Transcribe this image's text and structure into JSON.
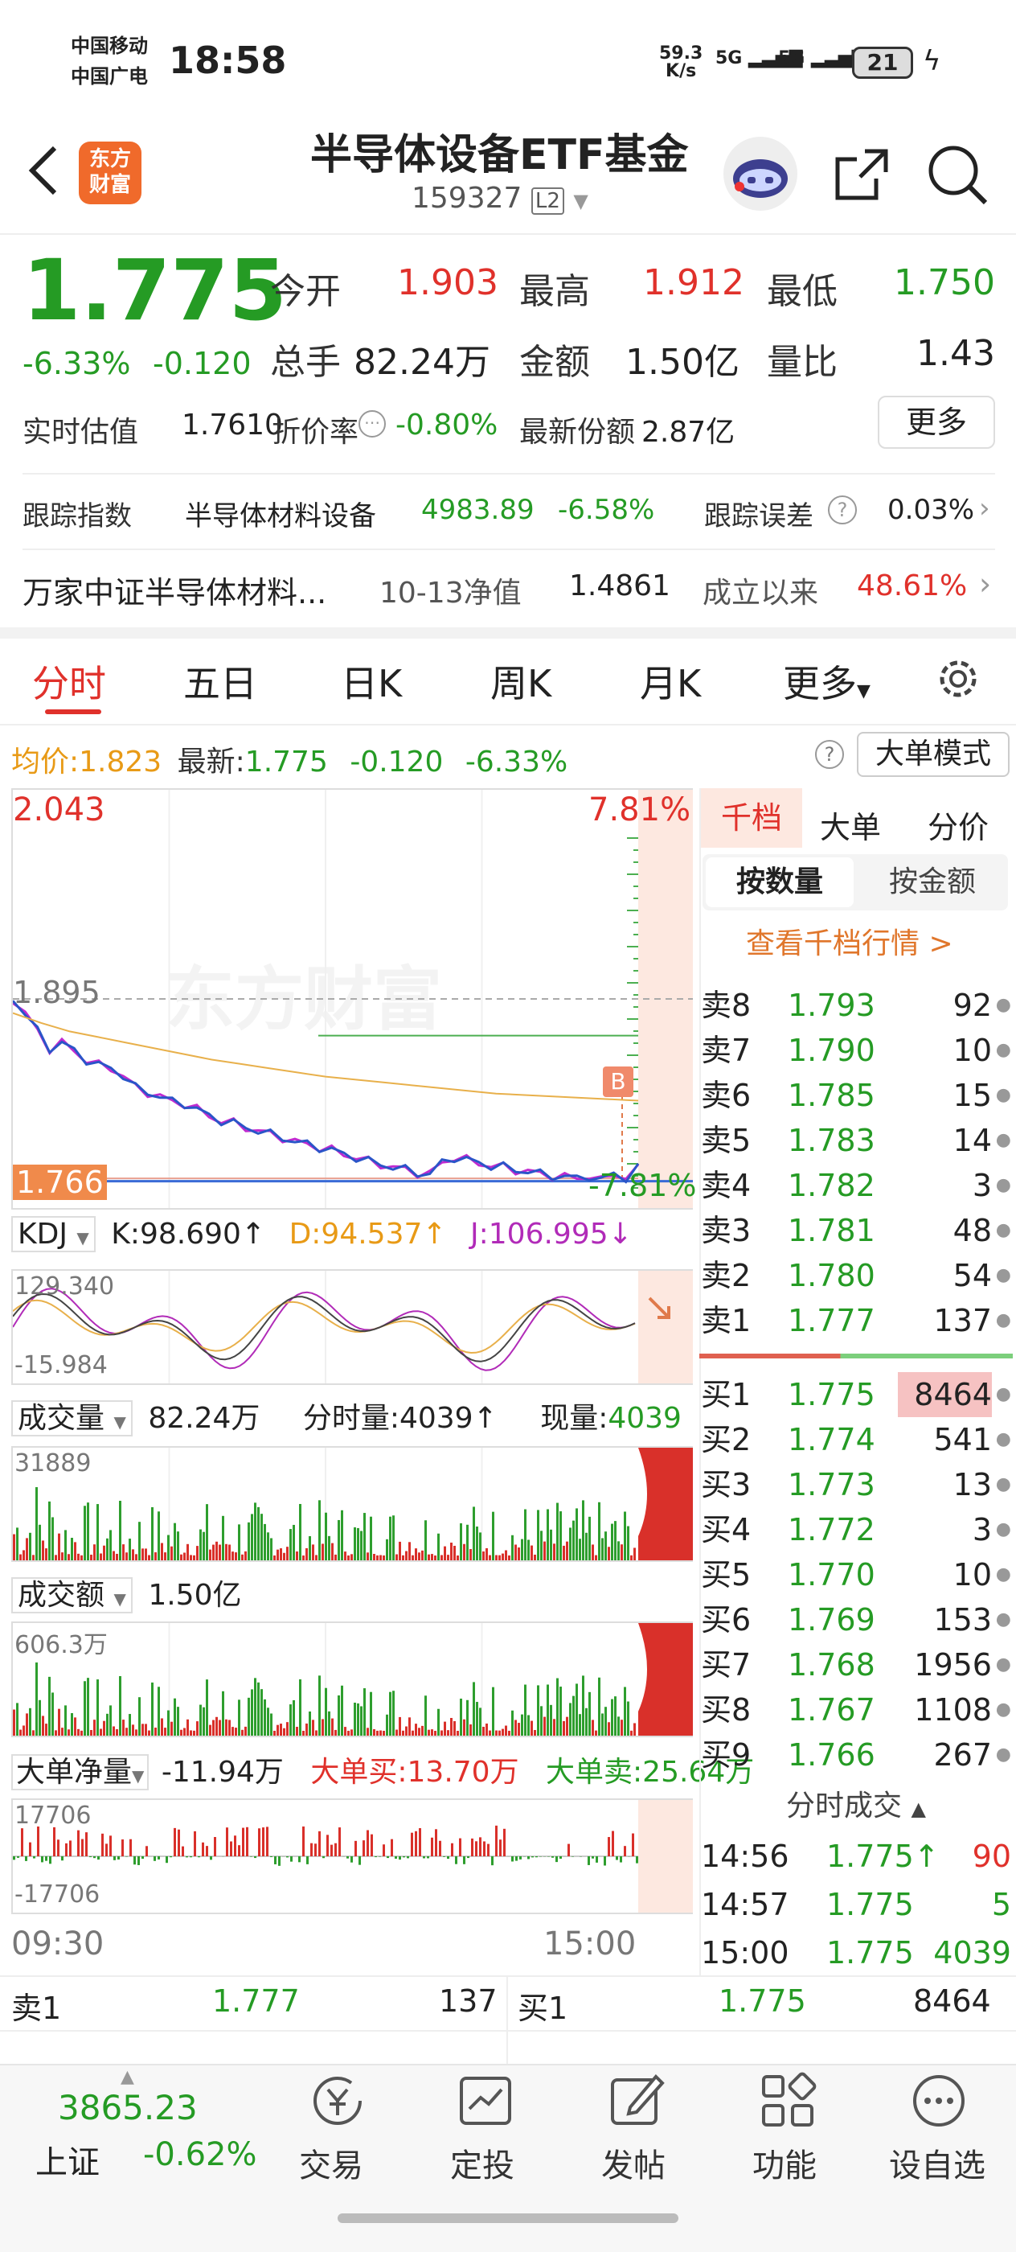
{
  "status": {
    "carrier1": "中国移动",
    "carrier2": "中国广电",
    "time": "18:58",
    "speed_val": "59.3",
    "speed_unit": "K/s",
    "sig1": "5G",
    "sig2": "5G",
    "battery": "21"
  },
  "header": {
    "logo_line1": "东方",
    "logo_line2": "财富",
    "title": "半导体设备ETF基金",
    "code": "159327",
    "badge": "L2"
  },
  "quote": {
    "price": "1.775",
    "pct": "-6.33%",
    "chg": "-0.120",
    "open_l": "今开",
    "open": "1.903",
    "high_l": "最高",
    "high": "1.912",
    "low_l": "最低",
    "low": "1.750",
    "vol_l": "总手",
    "vol": "82.24万",
    "amt_l": "金额",
    "amt": "1.50亿",
    "ratio_l": "量比",
    "ratio": "1.43",
    "est_l": "实时估值",
    "est": "1.7610",
    "disc_l": "折价率",
    "disc": "-0.80%",
    "share_l": "最新份额",
    "share": "2.87亿",
    "more": "更多"
  },
  "track": {
    "label": "跟踪指数",
    "index": "半导体材料设备",
    "value": "4983.89",
    "pct": "-6.58%",
    "err_l": "跟踪误差",
    "err": "0.03%"
  },
  "fund": {
    "name": "万家中证半导体材料...",
    "nav_l": "10-13净值",
    "nav": "1.4861",
    "since_l": "成立以来",
    "since": "48.61%"
  },
  "tabs": [
    "分时",
    "五日",
    "日K",
    "周K",
    "月K",
    "更多"
  ],
  "avgline": {
    "avg_l": "均价:",
    "avg": "1.823",
    "last_l": "最新:",
    "last": "1.775",
    "chg": "-0.120",
    "pct": "-6.33%",
    "mode": "大单模式"
  },
  "chart": {
    "top": "2.043",
    "top_pct": "7.81%",
    "ref": "1.895",
    "cur": "1.766",
    "bot_pct": "-7.81%",
    "b_mark": "B",
    "watermark": "东方财富",
    "price_line": [
      1.895,
      1.885,
      1.872,
      1.86,
      1.864,
      1.858,
      1.852,
      1.848,
      1.846,
      1.841,
      1.832,
      1.829,
      1.826,
      1.822,
      1.821,
      1.817,
      1.812,
      1.809,
      1.807,
      1.804,
      1.802,
      1.799,
      1.797,
      1.794,
      1.792,
      1.79,
      1.788,
      1.785,
      1.783,
      1.78,
      1.778,
      1.776,
      1.774,
      1.772,
      1.771,
      1.779,
      1.783,
      1.781,
      1.779,
      1.777,
      1.776,
      1.774,
      1.773,
      1.771,
      1.77,
      1.769,
      1.768,
      1.77,
      1.766,
      1.772,
      1.768,
      1.775
    ],
    "avg_line": [
      1.885,
      1.878,
      1.872,
      1.868,
      1.864,
      1.86,
      1.856,
      1.852,
      1.849,
      1.846,
      1.843,
      1.84,
      1.838,
      1.836,
      1.834,
      1.832,
      1.83,
      1.828,
      1.827,
      1.826,
      1.825,
      1.824,
      1.823
    ]
  },
  "kdj": {
    "label": "KDJ",
    "k": "K:98.690↑",
    "d": "D:94.537↑",
    "j": "J:106.995↓",
    "max": "129.340",
    "min": "-15.984"
  },
  "volume": {
    "label": "成交量",
    "total": "82.24万",
    "tick": "分时量:4039↑",
    "now_l": "现量:",
    "now": "4039",
    "max": "31889"
  },
  "amount": {
    "label": "成交额",
    "total": "1.50亿",
    "max": "606.3万"
  },
  "bigorder": {
    "label": "大单净量",
    "net": "-11.94万",
    "buy": "大单买:13.70万",
    "sell": "大单卖:25.64万",
    "max": "17706",
    "min": "-17706"
  },
  "axis": {
    "start": "09:30",
    "end": "15:00"
  },
  "book": {
    "tab1": "千档",
    "tab2": "大单",
    "tab3": "分价",
    "toggle1": "按数量",
    "toggle2": "按金额",
    "link": "查看千档行情 >",
    "asks": [
      {
        "l": "卖8",
        "p": "1.793",
        "v": "92"
      },
      {
        "l": "卖7",
        "p": "1.790",
        "v": "10"
      },
      {
        "l": "卖6",
        "p": "1.785",
        "v": "15"
      },
      {
        "l": "卖5",
        "p": "1.783",
        "v": "14"
      },
      {
        "l": "卖4",
        "p": "1.782",
        "v": "3"
      },
      {
        "l": "卖3",
        "p": "1.781",
        "v": "48"
      },
      {
        "l": "卖2",
        "p": "1.780",
        "v": "54"
      },
      {
        "l": "卖1",
        "p": "1.777",
        "v": "137"
      }
    ],
    "bids": [
      {
        "l": "买1",
        "p": "1.775",
        "v": "8464"
      },
      {
        "l": "买2",
        "p": "1.774",
        "v": "541"
      },
      {
        "l": "买3",
        "p": "1.773",
        "v": "13"
      },
      {
        "l": "买4",
        "p": "1.772",
        "v": "3"
      },
      {
        "l": "买5",
        "p": "1.770",
        "v": "10"
      },
      {
        "l": "买6",
        "p": "1.769",
        "v": "153"
      },
      {
        "l": "买7",
        "p": "1.768",
        "v": "1956"
      },
      {
        "l": "买8",
        "p": "1.767",
        "v": "1108"
      },
      {
        "l": "买9",
        "p": "1.766",
        "v": "267"
      }
    ],
    "trades_title": "分时成交",
    "trades": [
      {
        "t": "14:56",
        "p": "1.775↑",
        "v": "90"
      },
      {
        "t": "14:57",
        "p": "1.775",
        "v": "5"
      },
      {
        "t": "15:00",
        "p": "1.775",
        "v": "4039"
      }
    ]
  },
  "bottomq": {
    "s1": "卖1",
    "s1p": "1.777",
    "s1v": "137",
    "b1": "买1",
    "b1p": "1.775",
    "b1v": "8464"
  },
  "nav": {
    "index_val": "3865.23",
    "index_name": "上证",
    "index_pct": "-0.62%",
    "items": [
      "交易",
      "定投",
      "发帖",
      "功能",
      "设自选"
    ]
  }
}
